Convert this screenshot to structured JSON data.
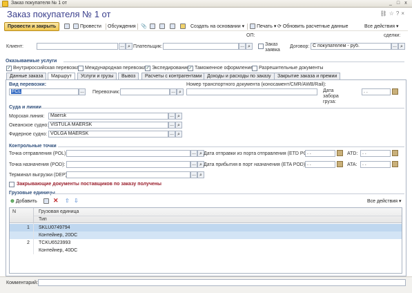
{
  "window": {
    "title": "Заказ покупателя № 1 от",
    "controls": [
      "_",
      "□",
      "x"
    ]
  },
  "doc_title": "Заказ покупателя № 1 от",
  "toolbar": {
    "post_close": "Провести и закрыть",
    "save": "",
    "print_docs": "Провести",
    "discussions": "Обсуждения",
    "create_based": "Создать на основании",
    "print": "Печать",
    "update_prices": "Обновить расчетные данные",
    "all_actions": "Все действия"
  },
  "header": {
    "op_label": "ОП:",
    "deals_label": "сделки:",
    "client_label": "Клиент:",
    "payer_label": "Плательщик:",
    "zakaz_zayavka": "Заказ заявка",
    "contract_label": "Договор:",
    "contract_value": "С покупателем - руб."
  },
  "services": {
    "title": "Оказываемые услуги",
    "items": [
      {
        "label": "Внутрироссийская перевозка",
        "checked": true
      },
      {
        "label": "Международная перевозка",
        "checked": false
      },
      {
        "label": "Экспедирование",
        "checked": true
      },
      {
        "label": "Таможенное оформление",
        "checked": true
      },
      {
        "label": "Разрешительные документы",
        "checked": false
      }
    ]
  },
  "tabs": [
    "Данные заказа",
    "Маршрут",
    "Услуги и грузы",
    "Вывоз",
    "Расчеты с контрагентами",
    "Доходы и расходы по заказу",
    "Закрытие заказа и премии"
  ],
  "route": {
    "transport_type_label": "Вид перевозки:",
    "transport_type_value": "FCL",
    "carrier_label": "Перевозчик:",
    "transport_doc_label": "Номер транспортного документа (коносамент/CMR/AWB/Rail):",
    "pickup_date_label": "Дата забора груза:",
    "date_placeholder": ". .",
    "vessels_title": "Суда и линии",
    "sea_line_label": "Морская линия:",
    "sea_line_value": "Maersk",
    "ocean_vessel_label": "Океанское судно:",
    "ocean_vessel_value": "VISTULA MAERSK",
    "feeder_label": "Фидерное судно:",
    "feeder_value": "VOLGA MAERSK",
    "checkpoints_title": "Контрольные точки",
    "pol_label": "Точка отправления (POL):",
    "pod_label": "Точка назначения (POD):",
    "dep_label": "Терминал выгрузки (DEP):",
    "etd_label": "Дата отправки из порта отправления (ETD POL):",
    "eta_label": "Дата прибытия в порт назначения (ETA POD):",
    "atd_label": "ATD:",
    "ata_label": "ATA:",
    "closing_docs_label": "Закрывающие документы поставщиков по заказу получены"
  },
  "cargo": {
    "title": "Грузовые единицы",
    "add_label": "Добавить",
    "all_actions": "Все действия",
    "col_n": "N",
    "col_unit": "Грузовая единица",
    "col_type": "Тип",
    "rows": [
      {
        "n": "1",
        "unit": "SKLU0749794",
        "type": "Контейнер, 20DC"
      },
      {
        "n": "2",
        "unit": "TCKU6523993",
        "type": "Контейнер, 40DC"
      }
    ]
  },
  "footer": {
    "comment_label": "Комментарий:"
  }
}
